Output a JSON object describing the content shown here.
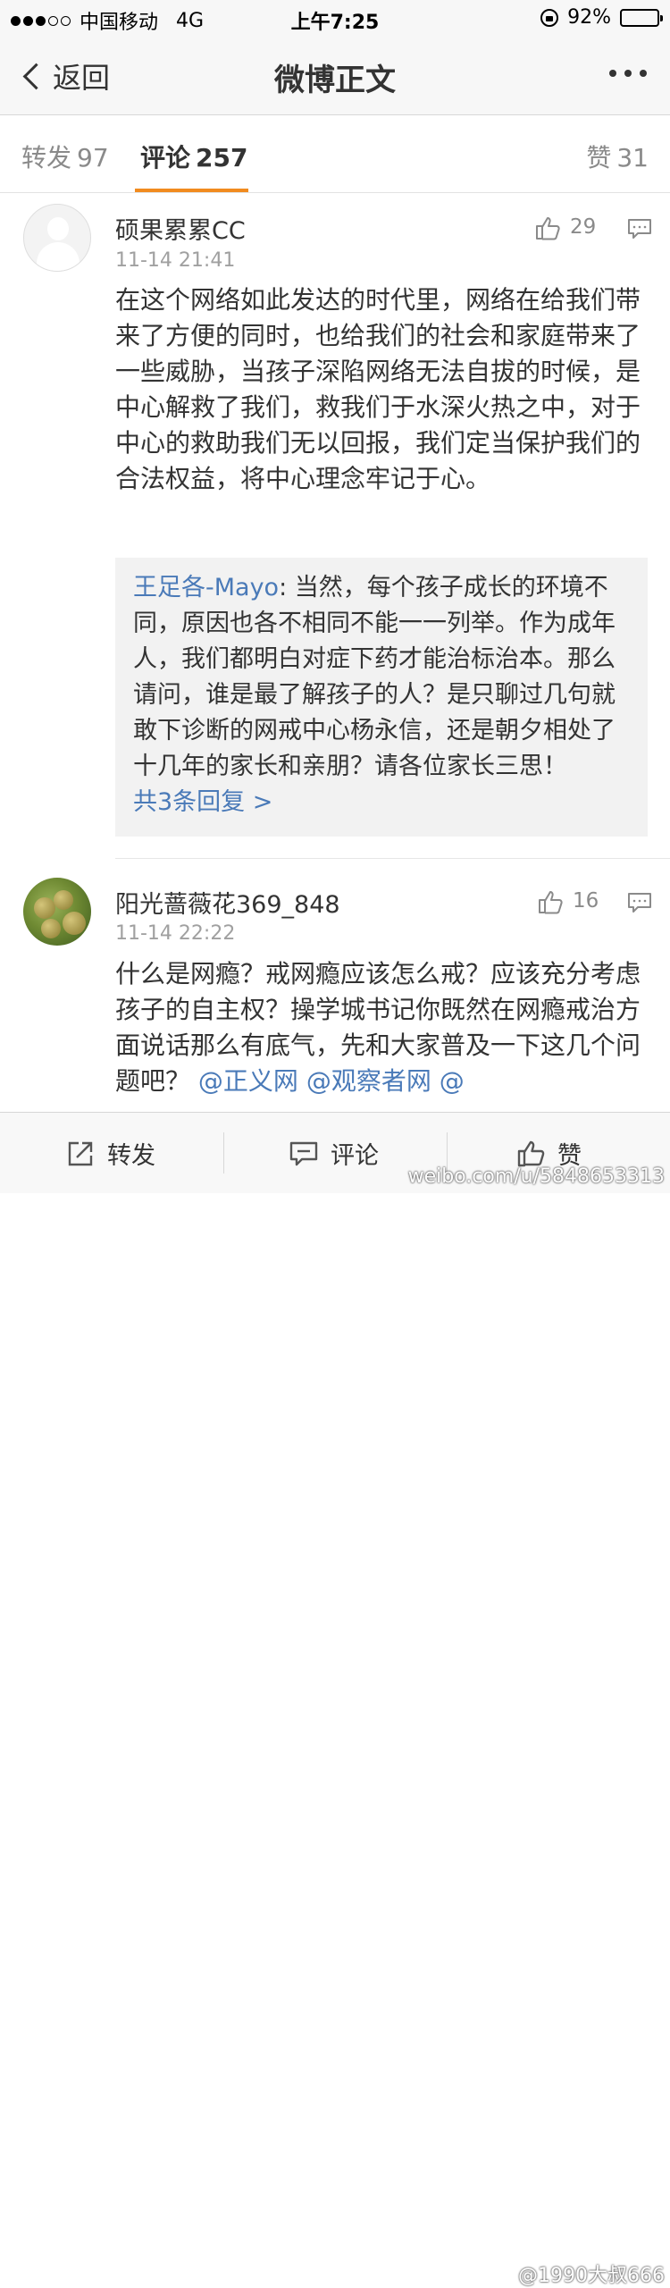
{
  "status_bar": {
    "carrier": "中国移动",
    "network": "4G",
    "time": "上午7:25",
    "battery": "92%"
  },
  "nav": {
    "back_label": "返回",
    "title": "微博正文"
  },
  "tabs": {
    "repost_label": "转发",
    "repost_count": "97",
    "comment_label": "评论",
    "comment_count": "257",
    "like_label": "赞",
    "like_count": "31"
  },
  "comments": [
    {
      "username": "硕果累累CC",
      "timestamp": "11-14 21:41",
      "likes": "29",
      "text": "在这个网络如此发达的时代里，网络在给我们带来了方便的同时，也给我们的社会和家庭带来了一些威胁，当孩子深陷网络无法自拔的时候，是中心解救了我们，救我们于水深火热之中，对于中心的救助我们无以回报，我们定当保护我们的合法权益，将中心理念牢记于心。",
      "reply": {
        "author": "王足各-Mayo",
        "text": "当然，每个孩子成长的环境不同，原因也各不相同不能一一列举。作为成年人，我们都明白对症下药才能治标治本。那么请问，谁是最了解孩子的人？是只聊过几句就敢下诊断的网戒中心杨永信，还是朝夕相处了十几年的家长和亲朋？请各位家长三思！",
        "more": "共3条回复 >"
      }
    },
    {
      "username": "阳光蔷薇花369_848",
      "timestamp": "11-14 22:22",
      "likes": "16",
      "text": "什么是网瘾？戒网瘾应该怎么戒？应该充分考虑孩子的自主权？操学城书记你既然在网瘾戒治方面说话那么有底气，先和大家普及一下这几个问题吧？",
      "mentions": "@正义网 @观察者网 @"
    }
  ],
  "bottom_bar": {
    "repost_label": "转发",
    "comment_label": "评论",
    "like_label": "赞"
  },
  "watermark": {
    "line1": "@1990大叔666",
    "line2": "weibo.com/u/5848653313"
  }
}
